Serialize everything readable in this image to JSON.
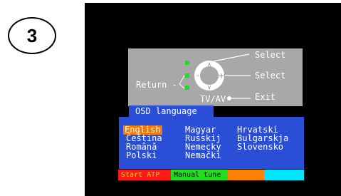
{
  "step_number": "3",
  "remote": {
    "select_up_label": "Select",
    "select_right_label": "Select",
    "return_label": "Return -",
    "tvav_label": "TV/AV",
    "exit_label": "Exit"
  },
  "menu_title": "OSD language",
  "languages": {
    "col1": [
      "English",
      "Čeština",
      "Română",
      "Polski"
    ],
    "col2": [
      "Magyar",
      "Russkij",
      "Nemecky",
      "Nemački"
    ],
    "col3": [
      "Hrvatski",
      "Bulgarskja",
      "Slovensko"
    ]
  },
  "selected_language": "English",
  "color_buttons": {
    "red_label": "Start ATP",
    "green_label": "Manual tune",
    "orange_label": "",
    "cyan_label": ""
  },
  "colors": {
    "red": "#ff1a1a",
    "green": "#22dd22",
    "orange": "#ff7f00",
    "cyan": "#00e5ff",
    "menu_blue": "#2a4fd6",
    "selection": "#f07a10",
    "remote_gray": "#a8a8a8"
  }
}
